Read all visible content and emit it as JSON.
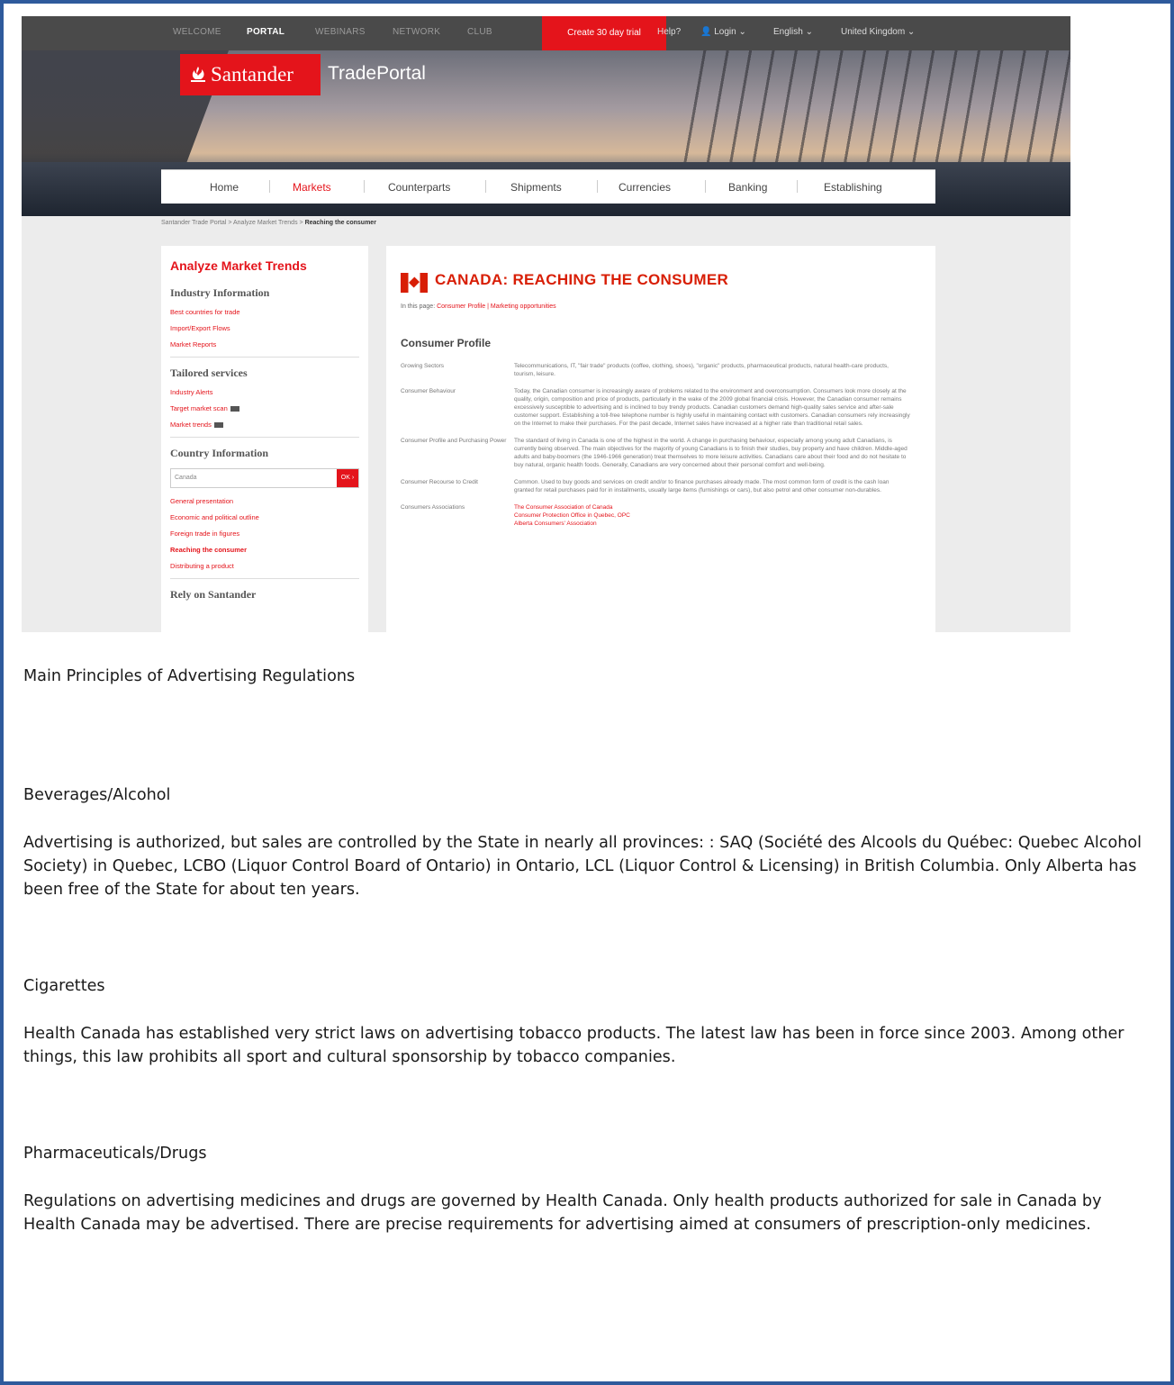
{
  "screenshot": {
    "topbar": {
      "tabs": [
        "WELCOME",
        "PORTAL",
        "WEBINARS",
        "NETWORK",
        "CLUB"
      ],
      "trial_label": "Create 30 day trial",
      "help_label": "Help?",
      "login_label": "Login",
      "language_label": "English",
      "country_label": "United Kingdom"
    },
    "logo": {
      "brand": "Santander",
      "product": "TradePortal"
    },
    "nav": [
      "Home",
      "Markets",
      "Counterparts",
      "Shipments",
      "Currencies",
      "Banking",
      "Establishing"
    ],
    "breadcrumb": {
      "item1": "Santander Trade Portal >",
      "item2": "Analyze Market Trends >",
      "current": "Reaching the consumer"
    },
    "sidebar": {
      "title": "Analyze Market Trends",
      "sections": [
        {
          "heading": "Industry Information",
          "links": [
            "Best countries for trade",
            "Import/Export Flows",
            "Market Reports"
          ]
        },
        {
          "heading": "Tailored services",
          "links": [
            "Industry Alerts",
            "Target market scan",
            "Market trends"
          ]
        },
        {
          "heading": "Country Information",
          "links": [
            "General presentation",
            "Economic and political outline",
            "Foreign trade in figures",
            "Reaching the consumer",
            "Distributing a product"
          ]
        }
      ],
      "country_value": "Canada",
      "ok_label": "OK ›",
      "rely_heading": "Rely on Santander"
    },
    "content": {
      "title": "CANADA: REACHING THE CONSUMER",
      "on_page_prefix": "In this page:",
      "on_page_links": "Consumer Profile | Marketing opportunities",
      "section": "Consumer Profile",
      "rows": [
        {
          "label": "Growing Sectors",
          "value": "Telecommunications, IT, \"fair trade\" products (coffee, clothing, shoes), \"organic\" products, pharmaceutical products, natural health-care products, tourism, leisure."
        },
        {
          "label": "Consumer Behaviour",
          "value": "Today, the Canadian consumer is increasingly aware of problems related to the environment and overconsumption. Consumers look more closely at the quality, origin, composition and price of products, particularly in the wake of the 2009 global financial crisis. However, the Canadian consumer remains excessively susceptible to advertising and is inclined to buy trendy products. Canadian customers demand high-quality sales service and after-sale customer support. Establishing a toll-free telephone number is highly useful in maintaining contact with customers. Canadian consumers rely increasingly on the Internet to make their purchases. For the past decade, Internet sales have increased at a higher rate than traditional retail sales."
        },
        {
          "label": "Consumer Profile and Purchasing Power",
          "value": "The standard of living in Canada is one of the highest in the world. A change in purchasing behaviour, especially among young adult Canadians, is currently being observed. The main objectives for the majority of young Canadians is to finish their studies, buy property and have children. Middle-aged adults and baby-boomers (the 1946-1966 generation) treat themselves to more leisure activities. Canadians care about their food and do not hesitate to buy natural, organic health foods. Generally, Canadians are very concerned about their personal comfort and well-being."
        },
        {
          "label": "Consumer Recourse to Credit",
          "value": "Common. Used to buy goods and services on credit and/or to finance purchases already made. The most common form of credit is the cash loan granted for retail purchases paid for in installments, usually large items (furnishings or cars), but also petrol and other consumer non-durables."
        },
        {
          "label": "Consumers Associations",
          "value": "The Consumer Association of Canada\nConsumer Protection Office in Quebec, OPC\nAlberta Consumers' Association"
        }
      ]
    }
  },
  "document": {
    "heading": "Main Principles of Advertising Regulations",
    "sections": [
      {
        "title": "Beverages/Alcohol",
        "text": "Advertising is authorized, but sales are controlled by the State in nearly all provinces: : SAQ (Société des Alcools du Québec: Quebec Alcohol Society) in Quebec, LCBO (Liquor Control Board of Ontario) in Ontario, LCL (Liquor Control & Licensing) in British Columbia. Only Alberta has been free of the State for about ten years."
      },
      {
        "title": "Cigarettes",
        "text": "Health Canada has established very strict laws on advertising tobacco products. The latest law has been in force since 2003. Among other things, this law prohibits all sport and cultural sponsorship by tobacco companies."
      },
      {
        "title": "Pharmaceuticals/Drugs",
        "text": "Regulations on advertising medicines and drugs are governed by Health Canada. Only health products authorized for sale in Canada by Health Canada may be advertised. There are precise requirements for advertising aimed at consumers of prescription-only medicines."
      }
    ]
  },
  "colors": {
    "brand_red": "#e4141b",
    "frame_blue": "#2e5a9c"
  }
}
